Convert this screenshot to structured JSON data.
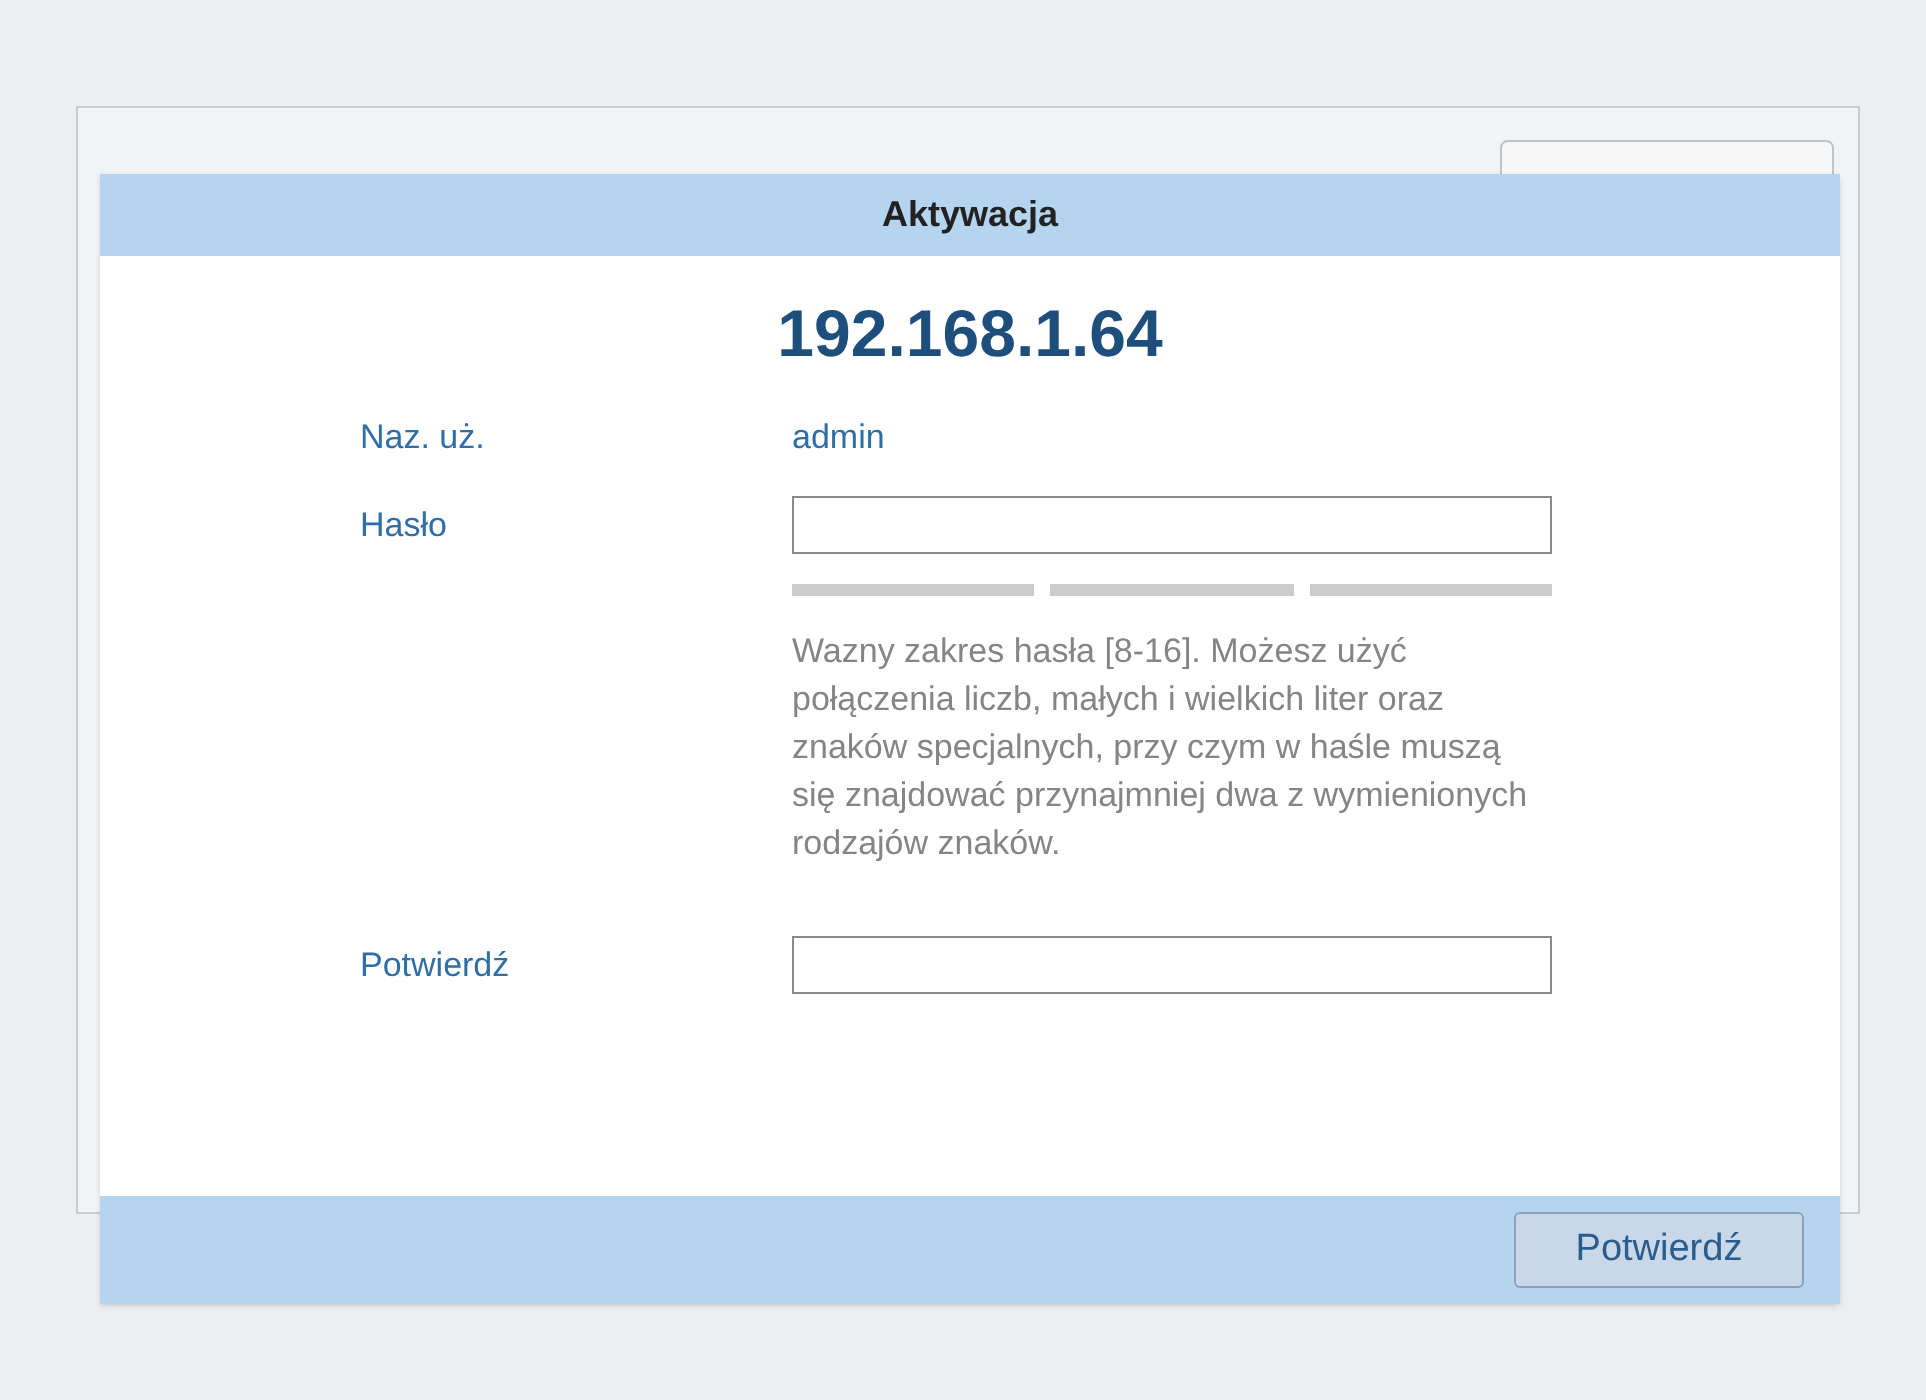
{
  "dialog": {
    "title": "Aktywacja",
    "address": "192.168.1.64",
    "fields": [
      {
        "kind": "text",
        "label": "Naz. uż.",
        "value": "admin"
      },
      {
        "kind": "password",
        "label": "Hasło"
      },
      {
        "kind": "strength"
      },
      {
        "kind": "hint",
        "text": "Wazny zakres hasła [8-16]. Możesz użyć połączenia liczb, małych i wielkich liter oraz znaków specjalnych, przy czym w haśle muszą się znajdować przynajmniej dwa z wymienionych rodzajów znaków."
      },
      {
        "kind": "password",
        "label": "Potwierdź"
      }
    ],
    "buttons": [
      "Potwierdź"
    ]
  }
}
